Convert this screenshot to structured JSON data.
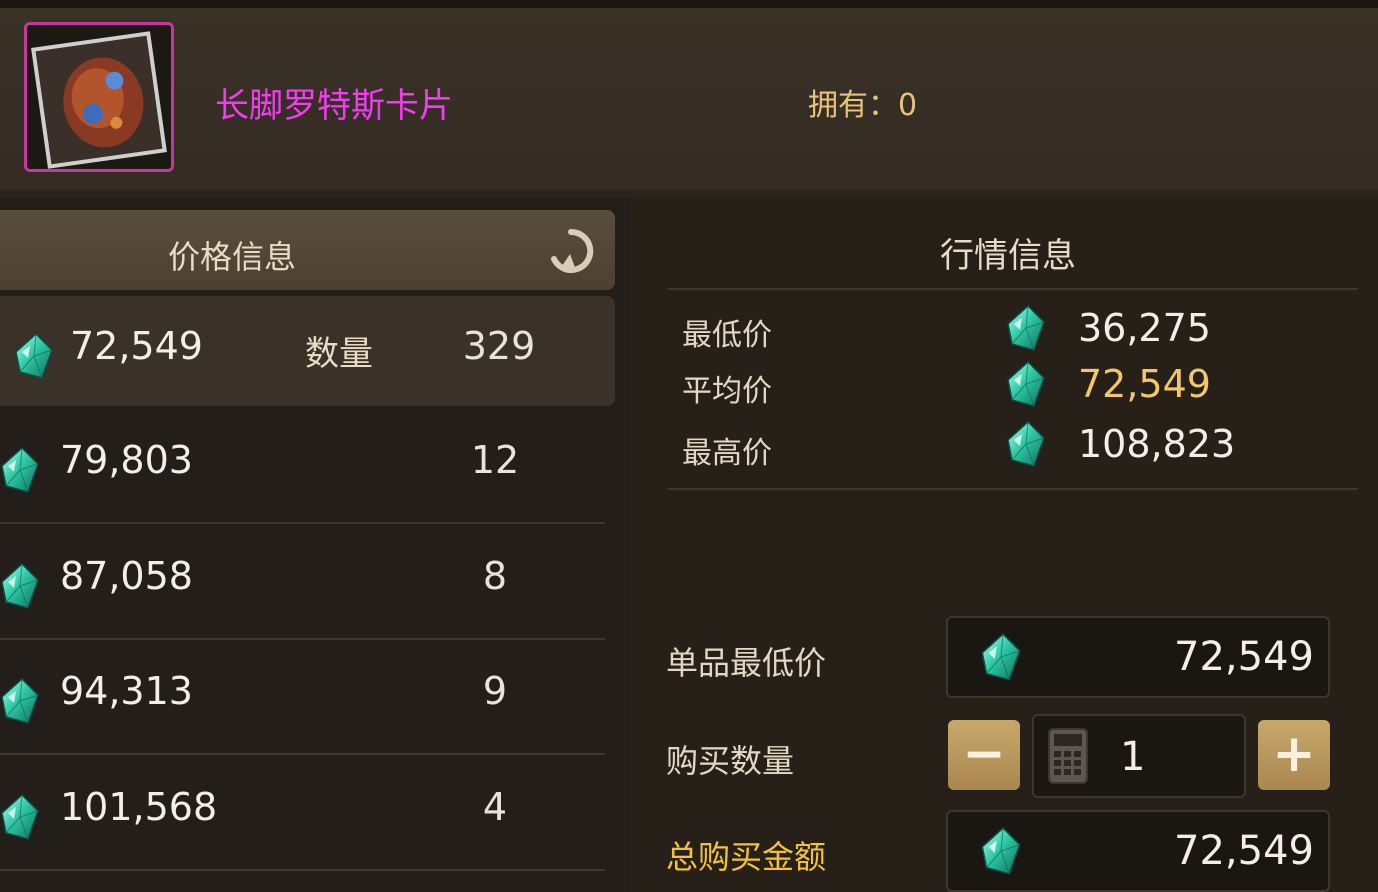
{
  "item": {
    "name": "长脚罗特斯卡片",
    "owned_label": "拥有：0",
    "card_icon": "monster-card-icon"
  },
  "price_panel": {
    "title": "价格信息",
    "refresh_icon": "refresh-icon",
    "quantity_label": "数量",
    "listings": [
      {
        "price": "72,549",
        "quantity": "329"
      },
      {
        "price": "79,803",
        "quantity": "12"
      },
      {
        "price": "87,058",
        "quantity": "8"
      },
      {
        "price": "94,313",
        "quantity": "9"
      },
      {
        "price": "101,568",
        "quantity": "4"
      }
    ]
  },
  "market_panel": {
    "title": "行情信息",
    "rows": [
      {
        "label": "最低价",
        "value": "36,275"
      },
      {
        "label": "平均价",
        "value": "72,549"
      },
      {
        "label": "最高价",
        "value": "108,823"
      }
    ]
  },
  "purchase": {
    "unit_label": "单品最低价",
    "unit_price": "72,549",
    "qty_label": "购买数量",
    "qty_value": "1",
    "minus": "−",
    "plus": "+",
    "total_label": "总购买金额",
    "total_price": "72,549"
  },
  "colors": {
    "item_name": "#f23cf0",
    "gold_text": "#f2c76a",
    "button_gold": "#c8a86a",
    "gem": "#2fc9a6"
  }
}
